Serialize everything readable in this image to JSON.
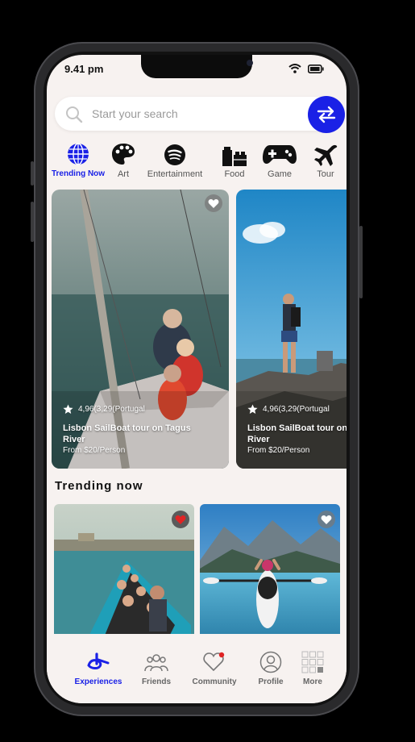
{
  "status": {
    "time": "9.41 pm"
  },
  "search": {
    "placeholder": "Start your search"
  },
  "categories": [
    {
      "label": "Trending Now",
      "icon": "globe-icon"
    },
    {
      "label": "Art",
      "icon": "palette-icon"
    },
    {
      "label": "Entertainment",
      "icon": "spotify-icon"
    },
    {
      "label": "Food",
      "icon": "food-icon"
    },
    {
      "label": "Game",
      "icon": "gamepad-icon"
    },
    {
      "label": "Tour",
      "icon": "airplane-icon"
    }
  ],
  "featured": [
    {
      "rating": "4,96(3,29(Portugal",
      "title": "Lisbon SailBoat tour on Tagus River",
      "price": "From $20/Person"
    },
    {
      "rating": "4,96(3,29(Portugal",
      "title": "Lisbon SailBoat tour on Tagus River",
      "price": "From $20/Person"
    }
  ],
  "trending": {
    "title": "Trending now"
  },
  "tabs": [
    {
      "label": "Experiences",
      "icon": "experiences-icon"
    },
    {
      "label": "Friends",
      "icon": "friends-icon"
    },
    {
      "label": "Community",
      "icon": "heart-icon"
    },
    {
      "label": "Profile",
      "icon": "profile-icon"
    },
    {
      "label": "More",
      "icon": "grid-icon"
    }
  ],
  "colors": {
    "accent": "#1a21e6",
    "background": "#f7f2f0",
    "favorite": "#e02424"
  }
}
